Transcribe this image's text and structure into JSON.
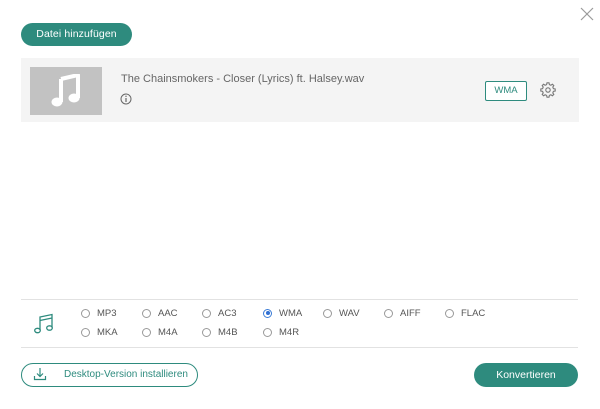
{
  "header": {
    "add_file_label": "Datei hinzufügen",
    "close_icon": "close-icon"
  },
  "file": {
    "name": "The Chainsmokers - Closer (Lyrics) ft. Halsey.wav",
    "thumbnail_icon": "music-note-icon",
    "info_icon": "info-icon",
    "output_format": "WMA",
    "settings_icon": "gear-icon"
  },
  "formats": {
    "icon": "music-icon",
    "options": [
      {
        "label": "MP3",
        "selected": false
      },
      {
        "label": "AAC",
        "selected": false
      },
      {
        "label": "AC3",
        "selected": false
      },
      {
        "label": "WMA",
        "selected": true
      },
      {
        "label": "WAV",
        "selected": false
      },
      {
        "label": "AIFF",
        "selected": false
      },
      {
        "label": "FLAC",
        "selected": false
      },
      {
        "label": "MKA",
        "selected": false
      },
      {
        "label": "M4A",
        "selected": false
      },
      {
        "label": "M4B",
        "selected": false
      },
      {
        "label": "M4R",
        "selected": false
      }
    ]
  },
  "footer": {
    "desktop_label": "Desktop-Version installieren",
    "download_icon": "download-icon",
    "convert_label": "Konvertieren"
  },
  "colors": {
    "accent": "#2e8b7e",
    "radio_selected": "#2f6fd3",
    "row_background": "#f4f4f4",
    "thumbnail_background": "#c2c2c2"
  }
}
